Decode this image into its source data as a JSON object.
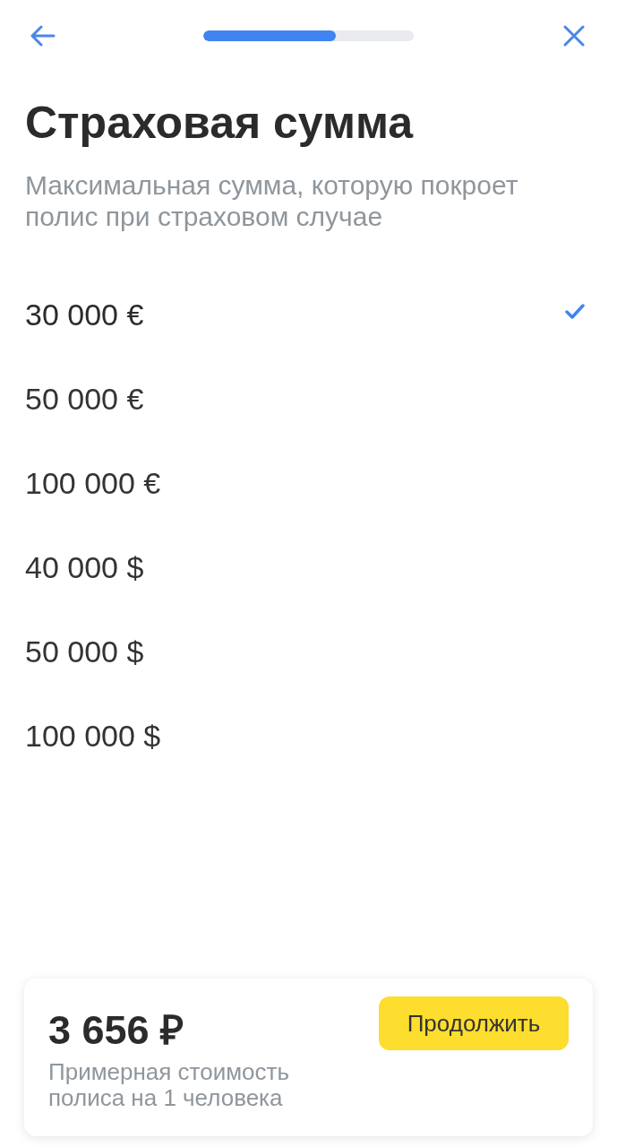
{
  "header": {
    "progress": {
      "level": 0.63
    }
  },
  "title": "Страховая сумма",
  "subtitle": "Максимальная сумма, которую покроет полис при страховом случае",
  "options": [
    {
      "label": "30 000 €",
      "selected": true
    },
    {
      "label": "50 000 €",
      "selected": false
    },
    {
      "label": "100 000 €",
      "selected": false
    },
    {
      "label": "40 000 $",
      "selected": false
    },
    {
      "label": "50 000 $",
      "selected": false
    },
    {
      "label": "100 000 $",
      "selected": false
    }
  ],
  "footer": {
    "price": "3 656 ₽",
    "note": "Примерная стоимость полиса на 1 человека",
    "button": "Продолжить"
  }
}
